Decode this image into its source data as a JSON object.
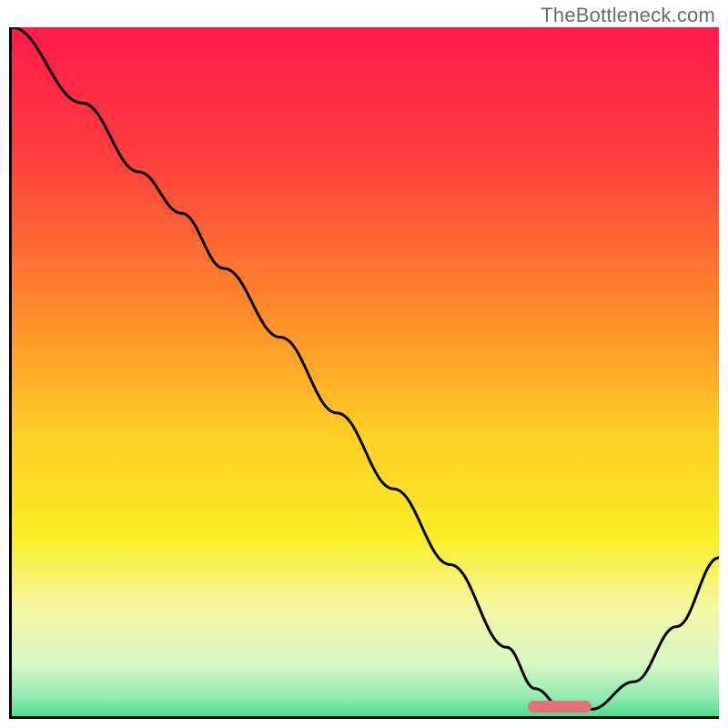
{
  "watermark": "TheBottleneck.com",
  "chart_data": {
    "type": "line",
    "title": "",
    "xlabel": "",
    "ylabel": "",
    "xlim": [
      0,
      100
    ],
    "ylim": [
      0,
      100
    ],
    "gradient_stops": [
      {
        "pos": 0,
        "color": "#ff1a4b"
      },
      {
        "pos": 18,
        "color": "#ff3d3d"
      },
      {
        "pos": 40,
        "color": "#ff8a2a"
      },
      {
        "pos": 58,
        "color": "#ffd024"
      },
      {
        "pos": 72,
        "color": "#f9ee23"
      },
      {
        "pos": 82,
        "color": "#f5f8a0"
      },
      {
        "pos": 90,
        "color": "#d9f7c4"
      },
      {
        "pos": 95,
        "color": "#8ce9b0"
      },
      {
        "pos": 99,
        "color": "#20d77a"
      },
      {
        "pos": 100,
        "color": "#18c86f"
      }
    ],
    "series": [
      {
        "name": "bottleneck-curve",
        "x": [
          0,
          10,
          18,
          24,
          30,
          38,
          46,
          54,
          62,
          70,
          74,
          78,
          82,
          88,
          94,
          100
        ],
        "y": [
          100,
          89,
          79,
          73,
          65,
          55,
          44,
          33,
          22,
          10,
          4,
          1,
          1,
          5,
          13,
          23
        ]
      }
    ],
    "marker": {
      "x_start": 73,
      "x_end": 82,
      "y": 1.5,
      "color": "#e77076"
    }
  }
}
